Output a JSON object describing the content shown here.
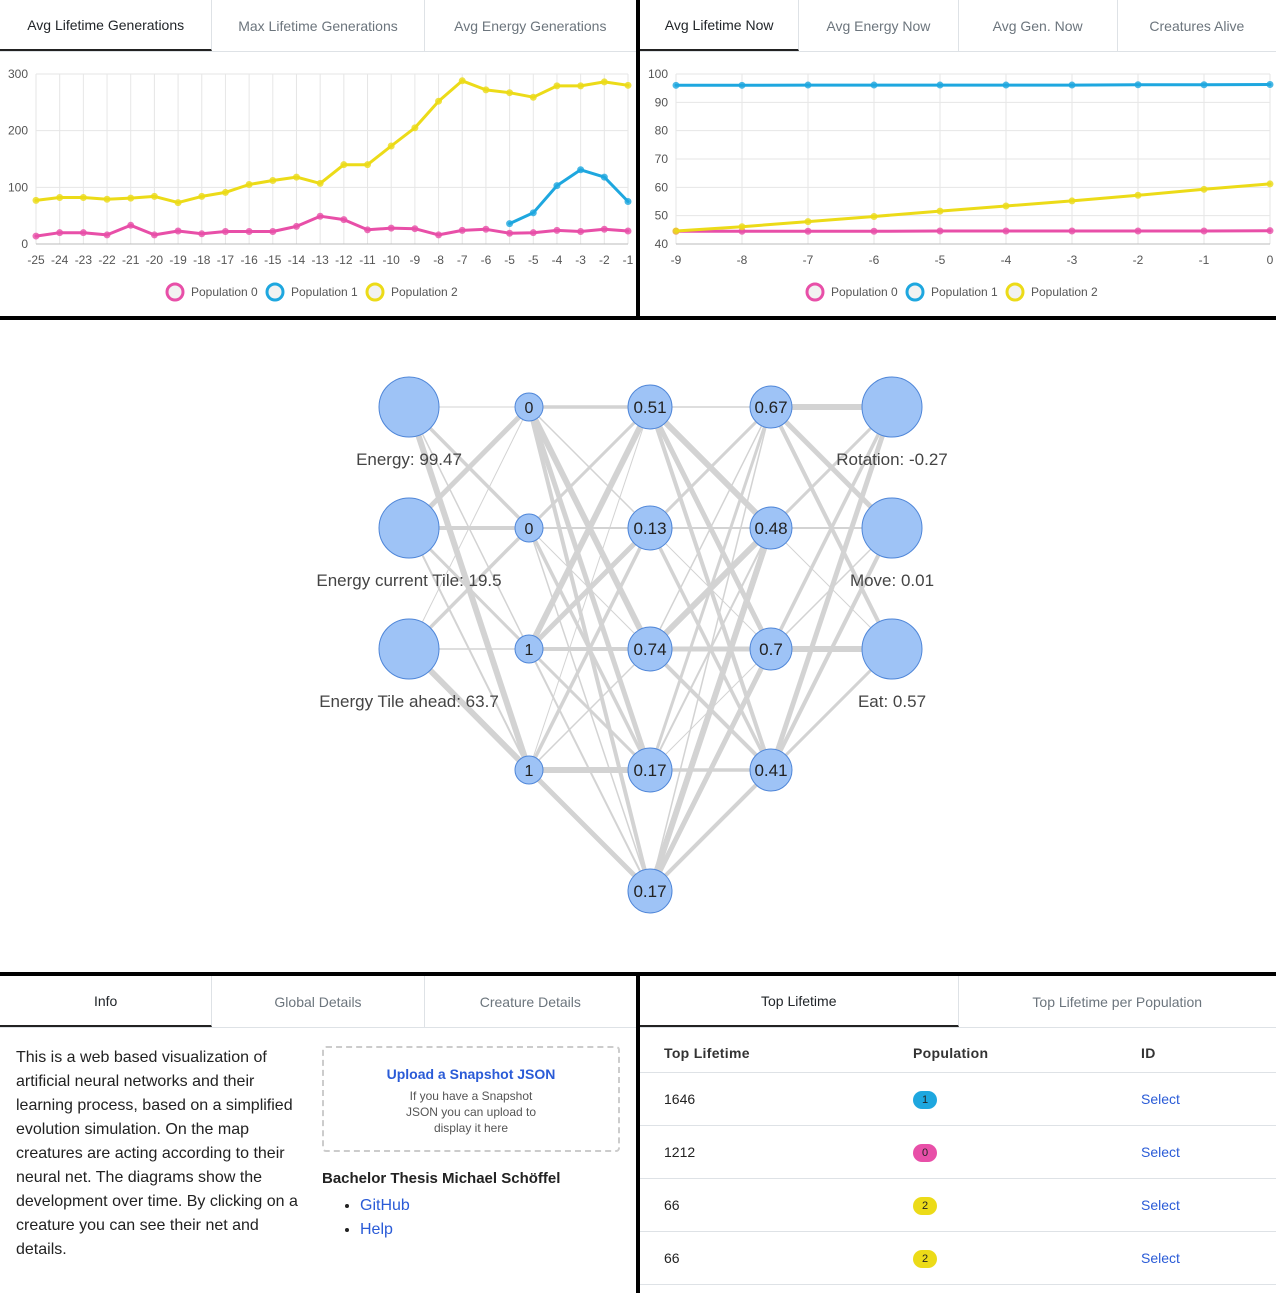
{
  "colors": {
    "population_0": "#e84fa8",
    "population_1": "#1ea7df",
    "population_2": "#ecdb18",
    "node_fill": "#9ec3f6",
    "node_stroke": "#4f86d8",
    "edge": "#d3d3d3"
  },
  "top_left": {
    "tabs": [
      {
        "label": "Avg Lifetime Generations",
        "active": true
      },
      {
        "label": "Max Lifetime Generations",
        "active": false
      },
      {
        "label": "Avg Energy Generations",
        "active": false
      }
    ]
  },
  "top_right": {
    "tabs": [
      {
        "label": "Avg Lifetime Now",
        "active": true
      },
      {
        "label": "Avg Energy Now",
        "active": false
      },
      {
        "label": "Avg Gen. Now",
        "active": false
      },
      {
        "label": "Creatures Alive",
        "active": false
      }
    ]
  },
  "chart_data": [
    {
      "type": "line",
      "title": "Avg Lifetime Generations",
      "x": [
        -25,
        -24,
        -23,
        -22,
        -21,
        -20,
        -19,
        -18,
        -17,
        -16,
        -15,
        -14,
        -13,
        -12,
        -11,
        -10,
        -9,
        -8,
        -7,
        -6,
        -5,
        -5,
        -4,
        -3,
        -2,
        -1
      ],
      "ylim": [
        0,
        300
      ],
      "yticks": [
        0,
        100,
        200,
        300
      ],
      "legend": "bottom",
      "grid": true,
      "series": [
        {
          "name": "Population 0",
          "color": "#e84fa8",
          "values": [
            14,
            20,
            20,
            16,
            33,
            16,
            23,
            18,
            22,
            22,
            22,
            31,
            49,
            43,
            25,
            28,
            27,
            16,
            24,
            26,
            19,
            20,
            24,
            22,
            26,
            23
          ]
        },
        {
          "name": "Population 1",
          "color": "#1ea7df",
          "values": [
            null,
            null,
            null,
            null,
            null,
            null,
            null,
            null,
            null,
            null,
            null,
            null,
            null,
            null,
            null,
            null,
            null,
            null,
            null,
            null,
            36,
            55,
            103,
            131,
            118,
            75
          ]
        },
        {
          "name": "Population 2",
          "color": "#ecdb18",
          "values": [
            77,
            82,
            82,
            79,
            81,
            84,
            73,
            84,
            91,
            105,
            112,
            118,
            107,
            140,
            140,
            173,
            205,
            252,
            288,
            272,
            267,
            259,
            279,
            279,
            286,
            280
          ]
        }
      ]
    },
    {
      "type": "line",
      "title": "Avg Lifetime Now",
      "x": [
        -9,
        -8,
        -7,
        -6,
        -5,
        -4,
        -3,
        -2,
        -1,
        0
      ],
      "ylim": [
        40,
        100
      ],
      "yticks": [
        40,
        50,
        60,
        70,
        80,
        90,
        100
      ],
      "legend": "bottom",
      "grid": true,
      "series": [
        {
          "name": "Population 0",
          "color": "#e84fa8",
          "values": [
            44.5,
            44.5,
            44.5,
            44.5,
            44.6,
            44.6,
            44.6,
            44.6,
            44.6,
            44.7
          ]
        },
        {
          "name": "Population 1",
          "color": "#1ea7df",
          "values": [
            96,
            96,
            96.1,
            96.1,
            96.1,
            96.1,
            96.1,
            96.2,
            96.2,
            96.3
          ]
        },
        {
          "name": "Population 2",
          "color": "#ecdb18",
          "values": [
            44.6,
            46.1,
            47.9,
            49.7,
            51.6,
            53.4,
            55.2,
            57.2,
            59.3,
            61.2
          ]
        }
      ]
    }
  ],
  "network": {
    "layers": [
      [
        "",
        "",
        ""
      ],
      [
        "0",
        "0",
        "1",
        "1"
      ],
      [
        "0.51",
        "0.13",
        "0.74",
        "0.17",
        "0.17"
      ],
      [
        "0.67",
        "0.48",
        "0.7",
        "0.41"
      ],
      [
        "",
        "",
        ""
      ]
    ],
    "input_labels": [
      "Energy: 99.47",
      "Energy current Tile: 19.5",
      "Energy Tile ahead: 63.7"
    ],
    "output_labels": [
      "Rotation: -0.27",
      "Move: 0.01",
      "Eat: 0.57"
    ]
  },
  "bottom_left": {
    "tabs": [
      {
        "label": "Info",
        "active": true
      },
      {
        "label": "Global Details",
        "active": false
      },
      {
        "label": "Creature Details",
        "active": false
      }
    ],
    "info_text": "This is a web based visualization of artificial neural networks and their learning process, based on a simplified evolution simulation. On the map creatures are acting according to their neural net. The diagrams show the development over time. By clicking on a creature you can see their net and details.",
    "upload_title": "Upload a Snapshot JSON",
    "upload_desc": "If you have a Snapshot JSON you can upload to display it here",
    "thesis": "Bachelor Thesis Michael Schöffel",
    "links": [
      "GitHub",
      "Help"
    ]
  },
  "bottom_right": {
    "tabs": [
      {
        "label": "Top Lifetime",
        "active": true
      },
      {
        "label": "Top Lifetime per Population",
        "active": false
      }
    ],
    "headers": [
      "Top Lifetime",
      "Population",
      "ID"
    ],
    "rows": [
      {
        "lifetime": "1646",
        "population": "1",
        "color": "#1ea7df",
        "action": "Select"
      },
      {
        "lifetime": "1212",
        "population": "0",
        "color": "#e84fa8",
        "action": "Select"
      },
      {
        "lifetime": "66",
        "population": "2",
        "color": "#ecdb18",
        "action": "Select"
      },
      {
        "lifetime": "66",
        "population": "2",
        "color": "#ecdb18",
        "action": "Select"
      }
    ]
  }
}
